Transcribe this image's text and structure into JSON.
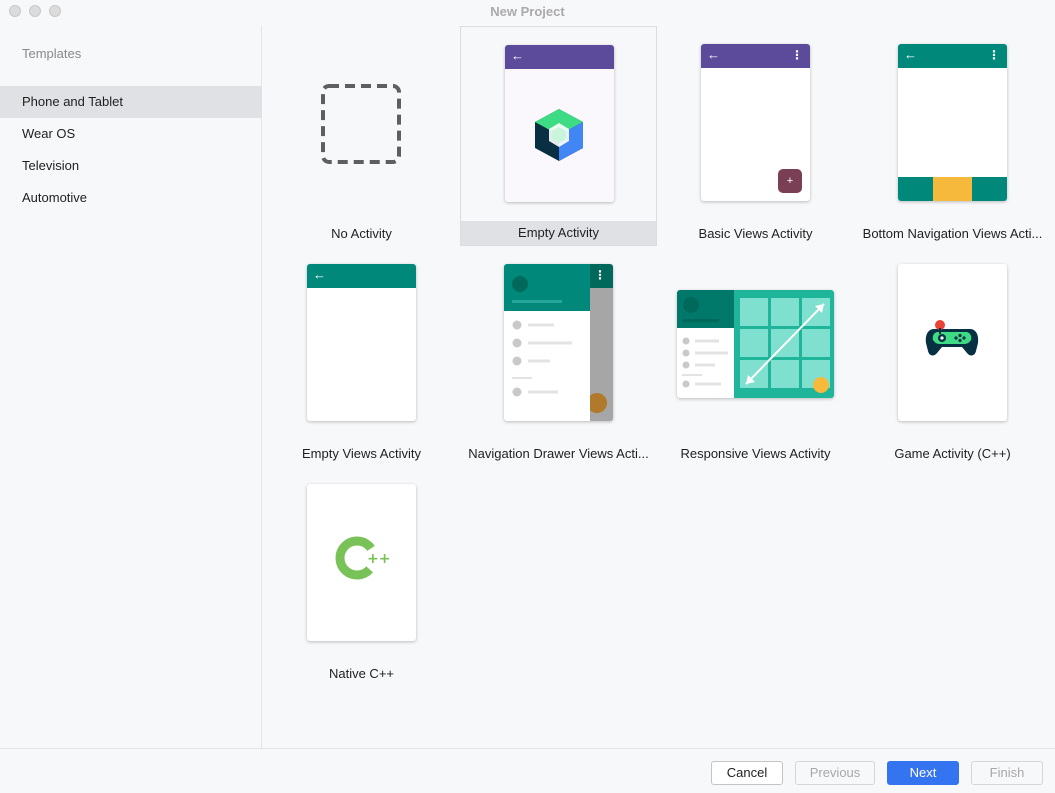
{
  "window": {
    "title": "New Project"
  },
  "sidebar": {
    "heading": "Templates",
    "items": [
      {
        "label": "Phone and Tablet",
        "selected": true
      },
      {
        "label": "Wear OS",
        "selected": false
      },
      {
        "label": "Television",
        "selected": false
      },
      {
        "label": "Automotive",
        "selected": false
      }
    ]
  },
  "templates": [
    {
      "label": "No Activity"
    },
    {
      "label": "Empty Activity",
      "selected": true
    },
    {
      "label": "Basic Views Activity"
    },
    {
      "label": "Bottom Navigation Views Acti..."
    },
    {
      "label": "Empty Views Activity"
    },
    {
      "label": "Navigation Drawer Views Acti..."
    },
    {
      "label": "Responsive Views Activity"
    },
    {
      "label": "Game Activity (C++)"
    },
    {
      "label": "Native C++"
    }
  ],
  "colors": {
    "purple_appbar": "#5c4b9b",
    "teal_appbar": "#00897b",
    "accent_yellow": "#f6b93b",
    "fab_maroon": "#7b3f55",
    "primary_button": "#3574f0"
  },
  "icons": {
    "back": "←",
    "menu": "⋮",
    "fab_plus": "+"
  },
  "footer": {
    "cancel": "Cancel",
    "previous": "Previous",
    "next": "Next",
    "finish": "Finish"
  }
}
